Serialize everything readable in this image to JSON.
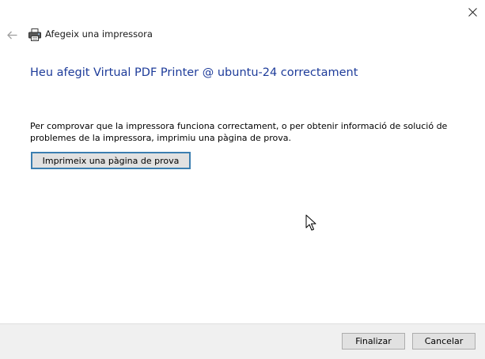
{
  "window": {
    "close_icon": "close-icon"
  },
  "header": {
    "back_icon": "back-arrow-icon",
    "printer_icon": "printer-icon",
    "title": "Afegeix una impressora"
  },
  "main": {
    "title": "Heu afegit Virtual PDF Printer @ ubuntu-24 correctament",
    "description": "Per comprovar que la impressora funciona correctament, o per obtenir informació de solució de problemes de la impressora, imprimiu una pàgina de prova.",
    "test_page_button": "Imprimeix una pàgina de prova"
  },
  "footer": {
    "finish_label": "Finalizar",
    "cancel_label": "Cancelar"
  },
  "colors": {
    "title_blue": "#1e3c9a",
    "focus_border": "#3c7fb1",
    "footer_bg": "#f0f0f0",
    "button_bg": "#e1e1e1"
  }
}
